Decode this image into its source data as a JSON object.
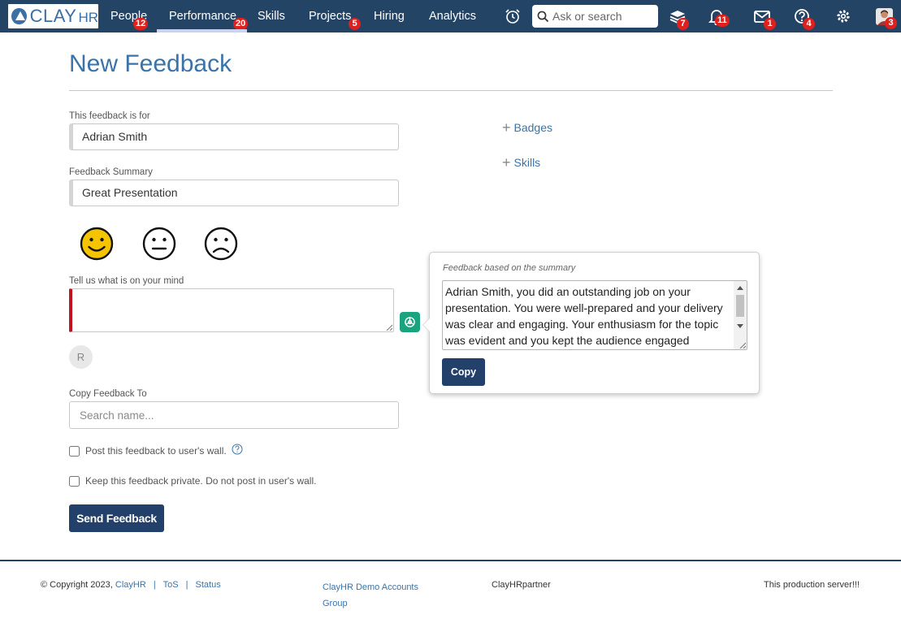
{
  "nav": {
    "logo_text": "CLAY",
    "logo_suffix": "HR",
    "items": [
      {
        "label": "People",
        "badge": "12"
      },
      {
        "label": "Performance",
        "badge": "20"
      },
      {
        "label": "Skills",
        "badge": ""
      },
      {
        "label": "Projects",
        "badge": "5"
      },
      {
        "label": "Hiring",
        "badge": ""
      },
      {
        "label": "Analytics",
        "badge": ""
      }
    ],
    "search_placeholder": "Ask or search",
    "icons": [
      {
        "name": "alarm-clock-icon",
        "badge": ""
      },
      {
        "name": "learning-stack-icon",
        "badge": "7"
      },
      {
        "name": "bell-icon",
        "badge": "11"
      },
      {
        "name": "mail-icon",
        "badge": "1"
      },
      {
        "name": "help-icon",
        "badge": "4"
      },
      {
        "name": "gear-icon",
        "badge": ""
      },
      {
        "name": "user-avatar-icon",
        "badge": "3"
      }
    ],
    "accent": "#244466"
  },
  "page": {
    "title": "New Feedback",
    "for_label": "This feedback is for",
    "for_value": "Adrian Smith",
    "summary_label": "Feedback Summary",
    "summary_value": "Great Presentation",
    "mind_label": "Tell us what is on your mind",
    "avatar_initial": "R",
    "copy_to_label": "Copy Feedback To",
    "copy_to_placeholder": "Search name...",
    "post_wall_label": "Post this feedback to user's wall.",
    "private_label": "Keep this feedback private. Do not post in user's wall.",
    "send_label": "Send Feedback",
    "badges_label": "Badges",
    "skills_label": "Skills",
    "emoji": [
      "happy-face-icon",
      "neutral-face-icon",
      "sad-face-icon"
    ],
    "selected_emoji_color": "#f5c400"
  },
  "popover": {
    "title": "Feedback based on the summary",
    "text": "Adrian Smith, you did an outstanding job on your presentation. You were well-prepared and your delivery was clear and engaging. Your enthusiasm for the topic was evident and you kept the audience engaged throughout.",
    "copy_label": "Copy"
  },
  "footer": {
    "copyright": "© Copyright 2023,",
    "brand_link": "ClayHR",
    "tos": "ToS",
    "status": "Status",
    "demo_accounts": "ClayHR Demo Accounts",
    "group": "Group",
    "partner": "ClayHRpartner",
    "server": "This production server!!!"
  }
}
